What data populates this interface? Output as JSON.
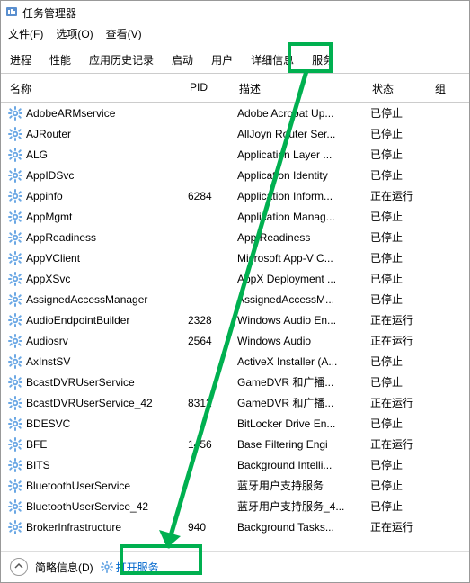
{
  "window": {
    "title": "任务管理器"
  },
  "menu": {
    "file": "文件(F)",
    "options": "选项(O)",
    "view": "查看(V)"
  },
  "tabs": {
    "processes": "进程",
    "performance": "性能",
    "history": "应用历史记录",
    "startup": "启动",
    "users": "用户",
    "details": "详细信息",
    "services": "服务"
  },
  "columns": {
    "name": "名称",
    "pid": "PID",
    "desc": "描述",
    "status": "状态",
    "group": "组"
  },
  "statusbar": {
    "fewer_details": "简略信息(D)",
    "open_services": "打开服务"
  },
  "highlight_color": "#00b050",
  "services": [
    {
      "name": "AdobeARMservice",
      "pid": "",
      "desc": "Adobe Acrobat Up...",
      "status": "已停止"
    },
    {
      "name": "AJRouter",
      "pid": "",
      "desc": "AllJoyn Router Ser...",
      "status": "已停止"
    },
    {
      "name": "ALG",
      "pid": "",
      "desc": "Application Layer ...",
      "status": "已停止"
    },
    {
      "name": "AppIDSvc",
      "pid": "",
      "desc": "Application Identity",
      "status": "已停止"
    },
    {
      "name": "Appinfo",
      "pid": "6284",
      "desc": "Application Inform...",
      "status": "正在运行"
    },
    {
      "name": "AppMgmt",
      "pid": "",
      "desc": "Application Manag...",
      "status": "已停止"
    },
    {
      "name": "AppReadiness",
      "pid": "",
      "desc": "App Readiness",
      "status": "已停止"
    },
    {
      "name": "AppVClient",
      "pid": "",
      "desc": "Microsoft App-V C...",
      "status": "已停止"
    },
    {
      "name": "AppXSvc",
      "pid": "",
      "desc": "AppX Deployment ...",
      "status": "已停止"
    },
    {
      "name": "AssignedAccessManager",
      "pid": "",
      "desc": "AssignedAccessM...",
      "status": "已停止"
    },
    {
      "name": "AudioEndpointBuilder",
      "pid": "2328",
      "desc": "Windows Audio En...",
      "status": "正在运行"
    },
    {
      "name": "Audiosrv",
      "pid": "2564",
      "desc": "Windows Audio",
      "status": "正在运行"
    },
    {
      "name": "AxInstSV",
      "pid": "",
      "desc": "ActiveX Installer (A...",
      "status": "已停止"
    },
    {
      "name": "BcastDVRUserService",
      "pid": "",
      "desc": "GameDVR 和广播...",
      "status": "已停止"
    },
    {
      "name": "BcastDVRUserService_42",
      "pid": "8312",
      "desc": "GameDVR 和广播...",
      "status": "正在运行"
    },
    {
      "name": "BDESVC",
      "pid": "",
      "desc": "BitLocker Drive En...",
      "status": "已停止"
    },
    {
      "name": "BFE",
      "pid": "1456",
      "desc": "Base Filtering Engi",
      "status": "正在运行"
    },
    {
      "name": "BITS",
      "pid": "",
      "desc": "Background Intelli...",
      "status": "已停止"
    },
    {
      "name": "BluetoothUserService",
      "pid": "",
      "desc": "蓝牙用户支持服务",
      "status": "已停止"
    },
    {
      "name": "BluetoothUserService_42",
      "pid": "",
      "desc": "蓝牙用户支持服务_4...",
      "status": "已停止"
    },
    {
      "name": "BrokerInfrastructure",
      "pid": "940",
      "desc": "Background Tasks...",
      "status": "正在运行"
    }
  ]
}
